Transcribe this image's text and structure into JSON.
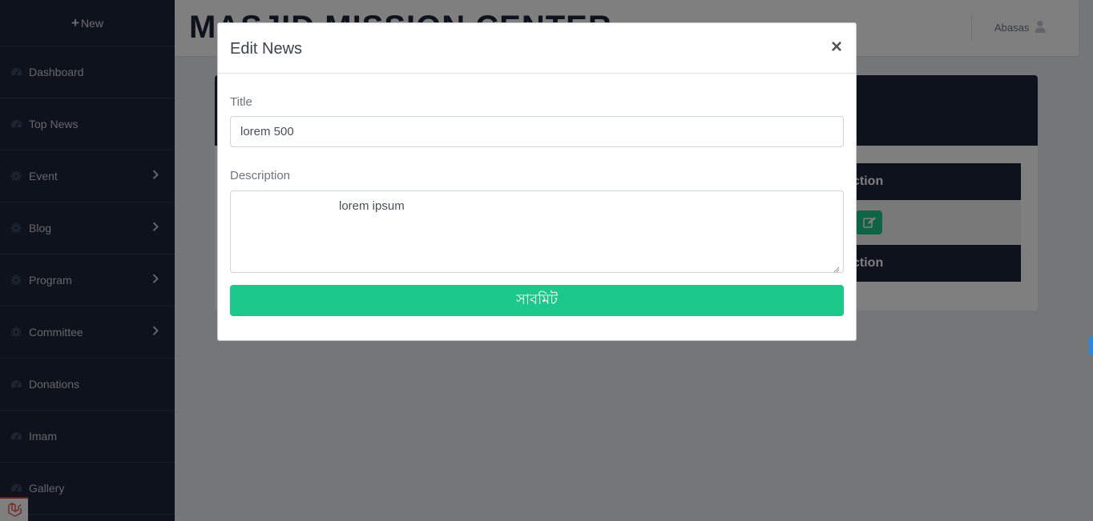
{
  "sidebar": {
    "new_label": "New",
    "items": [
      {
        "label": "Dashboard",
        "icon": "tachometer-icon",
        "has_chevron": false
      },
      {
        "label": "Top News",
        "icon": "tachometer-icon",
        "has_chevron": false
      },
      {
        "label": "Event",
        "icon": "cog-icon",
        "has_chevron": true
      },
      {
        "label": "Blog",
        "icon": "cog-icon",
        "has_chevron": true
      },
      {
        "label": "Program",
        "icon": "cog-icon",
        "has_chevron": true
      },
      {
        "label": "Committee",
        "icon": "cog-icon",
        "has_chevron": true
      },
      {
        "label": "Donations",
        "icon": "tachometer-icon",
        "has_chevron": false
      },
      {
        "label": "Imam",
        "icon": "tachometer-icon",
        "has_chevron": false
      },
      {
        "label": "Gallery",
        "icon": "tachometer-icon",
        "has_chevron": false
      }
    ]
  },
  "header": {
    "site_title": "MASJID MISSION CENTER",
    "user_name": "Abasas"
  },
  "background_table": {
    "header_label": "ction",
    "footer_label": "ction"
  },
  "modal": {
    "title": "Edit News",
    "close_label": "×",
    "title_label": "Title",
    "title_value": "lorem 500",
    "description_label": "Description",
    "description_value": "lorem ipsum",
    "submit_label": "সাবমিট"
  },
  "colors": {
    "sidebar_bg": "#1b2538",
    "accent_green": "#1cc88a",
    "brand_red": "#e3342f"
  }
}
